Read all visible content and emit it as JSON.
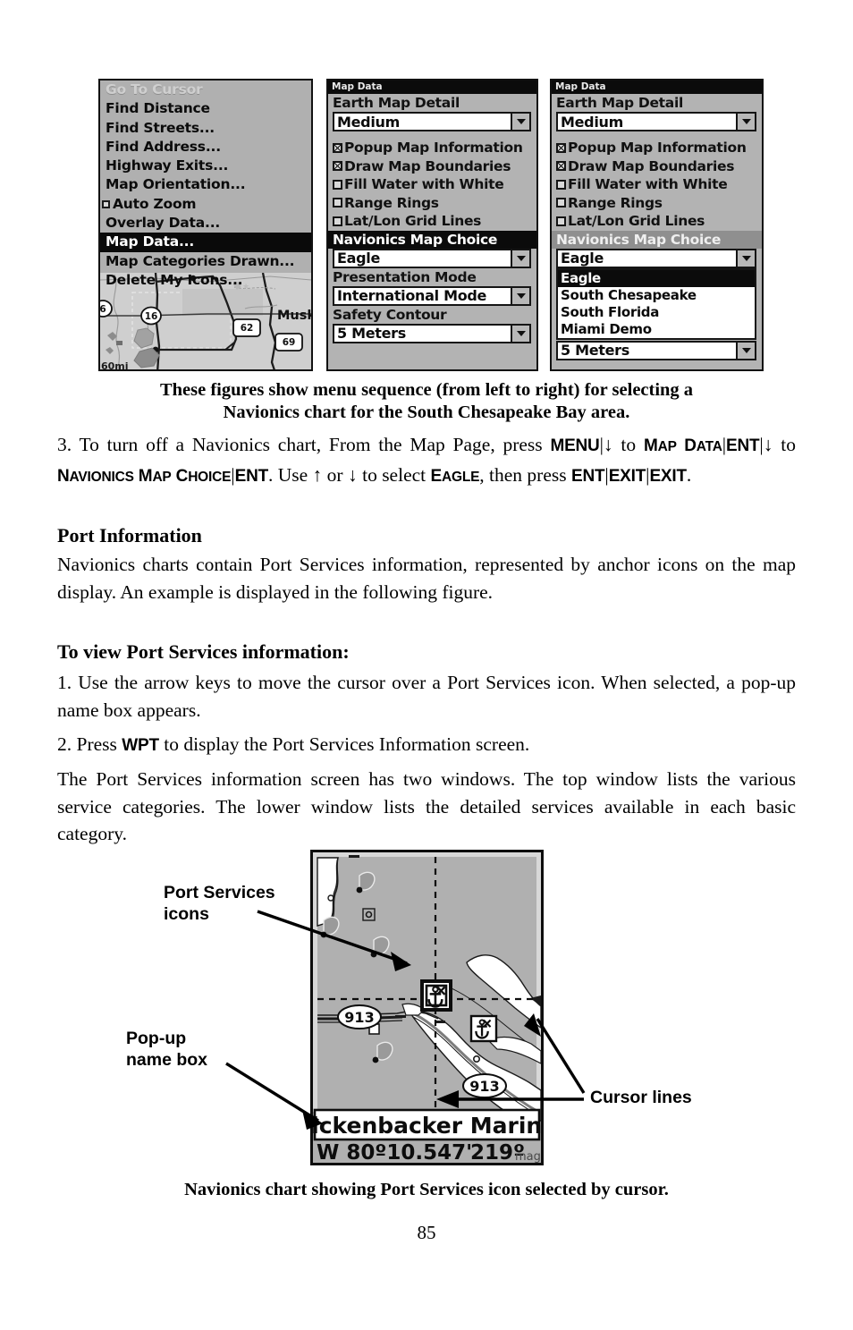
{
  "figure1": {
    "panel1": {
      "menu_items": [
        {
          "label": "Go To Cursor",
          "state": "disabled"
        },
        {
          "label": "Find Distance",
          "state": "normal"
        },
        {
          "label": "Find Streets...",
          "state": "normal"
        },
        {
          "label": "Find Address...",
          "state": "normal"
        },
        {
          "label": "Highway Exits...",
          "state": "normal"
        },
        {
          "label": "Map Orientation...",
          "state": "normal"
        },
        {
          "label": "Auto Zoom",
          "state": "checkbox-off"
        },
        {
          "label": "Overlay Data...",
          "state": "normal"
        },
        {
          "label": "Map Data...",
          "state": "selected"
        },
        {
          "label": "Map Categories Drawn...",
          "state": "normal"
        },
        {
          "label": "Delete My Icons...",
          "state": "normal"
        }
      ],
      "map": {
        "scale": "60mi",
        "city": "Muskog",
        "route_shields": [
          "6",
          "16",
          "62",
          "69"
        ]
      }
    },
    "panel2": {
      "title": "Map Data",
      "earth_map_detail_label": "Earth Map Detail",
      "earth_map_detail_value": "Medium",
      "checkboxes": [
        {
          "label": "Popup Map Information",
          "checked": true
        },
        {
          "label": "Draw Map Boundaries",
          "checked": true
        },
        {
          "label": "Fill Water with White",
          "checked": false
        },
        {
          "label": "Range Rings",
          "checked": false
        },
        {
          "label": "Lat/Lon Grid Lines",
          "checked": false
        }
      ],
      "navionics_label": "Navionics Map Choice",
      "navionics_value": "Eagle",
      "presentation_label": "Presentation Mode",
      "presentation_value": "International Mode",
      "safety_label": "Safety Contour",
      "safety_value": "5 Meters"
    },
    "panel3": {
      "title": "Map Data",
      "earth_map_detail_label": "Earth Map Detail",
      "earth_map_detail_value": "Medium",
      "checkboxes": [
        {
          "label": "Popup Map Information",
          "checked": true
        },
        {
          "label": "Draw Map Boundaries",
          "checked": true
        },
        {
          "label": "Fill Water with White",
          "checked": false
        },
        {
          "label": "Range Rings",
          "checked": false
        },
        {
          "label": "Lat/Lon Grid Lines",
          "checked": false
        }
      ],
      "navionics_label": "Navionics Map Choice",
      "navionics_value": "Eagle",
      "dropdown_options": [
        "Eagle",
        "South Chesapeake",
        "South Florida",
        "Miami Demo"
      ],
      "dropdown_selected": "Eagle",
      "safety_value": "5 Meters"
    },
    "caption_line1": "These figures show menu sequence (from left to right) for selecting a",
    "caption_line2": "Navionics chart for the South Chesapeake Bay area."
  },
  "body": {
    "step3_pre": "3. To turn off a Navionics chart, From the Map Page, press ",
    "step3_key_menu": "MENU",
    "step3_to1": " to ",
    "step3_mapdata": "Map Data",
    "step3_ent1": "ENT",
    "step3_to2": " to ",
    "step3_navchoice": "Navionics Map Choice",
    "step3_ent2": "ENT",
    "step3_mid": ". Use ↑ or ↓ to select ",
    "step3_eagle": "Eagle",
    "step3_then": ", then press ",
    "step3_ent3": "ENT",
    "step3_exit1": "EXIT",
    "step3_exit2": "EXIT",
    "step3_period": ".",
    "heading_port_information": "Port Information",
    "para_port": "Navionics charts contain Port Services information, represented by anchor icons on the map display. An example is displayed in the following figure.",
    "heading_to_view": "To view Port Services information:",
    "step1": "1. Use the arrow keys to move the cursor over a Port Services icon. When selected, a pop-up name box appears.",
    "step2_pre": "2. Press ",
    "step2_key": "WPT",
    "step2_post": " to display the Port Services Information screen.",
    "para_two_windows": "The Port Services information screen has two windows. The top window lists the various service categories. The lower window lists the detailed services available in each basic category."
  },
  "figure2": {
    "annotations": {
      "port_services_icons": "Port Services\nicons",
      "popup_name_box": "Pop-up\nname box",
      "cursor_lines": "Cursor lines"
    },
    "screen": {
      "popup_name": "Rickenbacker Marina",
      "longitude": "W 80º10.547'",
      "bearing": "219º",
      "bearing_unit": "mag",
      "depth_labels": [
        "913",
        "913"
      ],
      "port_service_icon": "anchor-icon"
    },
    "caption": "Navionics chart showing Port Services icon selected by cursor."
  },
  "page": {
    "number": "85"
  },
  "colors": {
    "screen_bg": "#b3b3b3",
    "screen_ink": "#0b0b0b",
    "selected_bg": "#0a0a0a",
    "selected_fg": "#ffffff",
    "gray_title": "#8f8f8f"
  }
}
